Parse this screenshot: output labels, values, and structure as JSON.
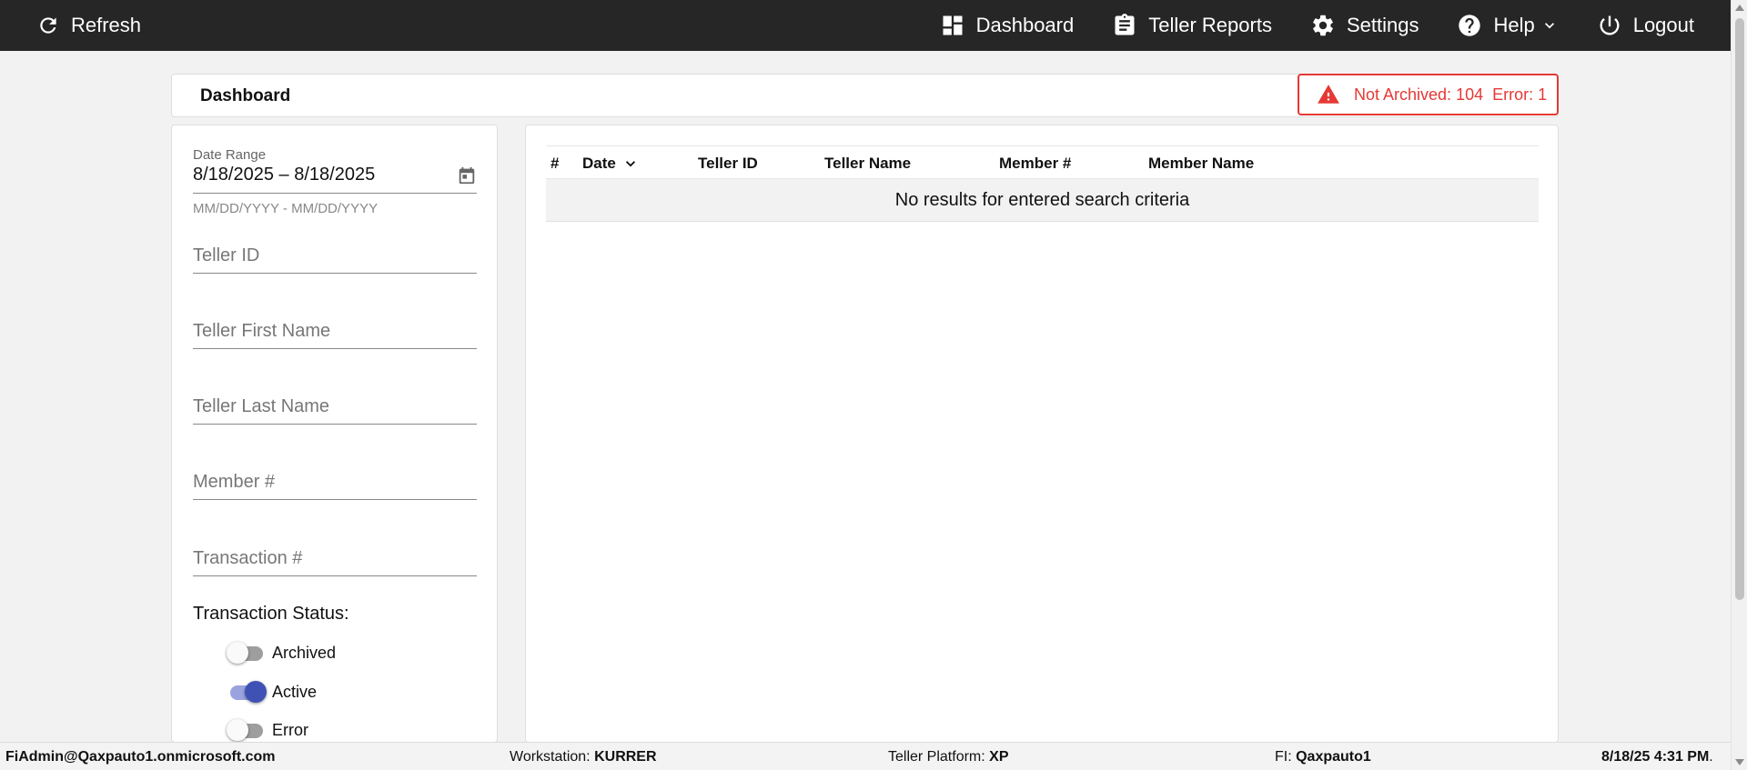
{
  "nav": {
    "refresh_label": "Refresh",
    "dashboard_label": "Dashboard",
    "teller_reports_label": "Teller Reports",
    "settings_label": "Settings",
    "help_label": "Help",
    "logout_label": "Logout"
  },
  "header": {
    "title": "Dashboard",
    "alert": {
      "not_archived": "Not Archived: 104",
      "error": "Error: 1",
      "color": "#e53935"
    }
  },
  "filters": {
    "date_range": {
      "label": "Date Range",
      "value": "8/18/2025 – 8/18/2025",
      "hint": "MM/DD/YYYY - MM/DD/YYYY"
    },
    "teller_id_placeholder": "Teller ID",
    "teller_first_name_placeholder": "Teller First Name",
    "teller_last_name_placeholder": "Teller Last Name",
    "member_number_placeholder": "Member #",
    "transaction_number_placeholder": "Transaction #",
    "status_label": "Transaction Status:",
    "statuses": [
      {
        "label": "Archived",
        "on": false
      },
      {
        "label": "Active",
        "on": true
      },
      {
        "label": "Error",
        "on": false
      }
    ]
  },
  "table": {
    "columns": [
      "#",
      "Date",
      "Teller ID",
      "Teller Name",
      "Member #",
      "Member Name"
    ],
    "empty_message": "No results for entered search criteria"
  },
  "footer": {
    "user": "FiAdmin@Qaxpauto1.onmicrosoft.com",
    "workstation_label": "Workstation: ",
    "workstation_value": "KURRER",
    "platform_label": "Teller Platform: ",
    "platform_value": "XP",
    "fi_label": "FI: ",
    "fi_value": "Qaxpauto1",
    "datetime": "8/18/25 4:31 PM",
    "datetime_suffix": "."
  },
  "colors": {
    "topbar": "#262626",
    "accent": "#3f51b5",
    "alert": "#e53935"
  }
}
